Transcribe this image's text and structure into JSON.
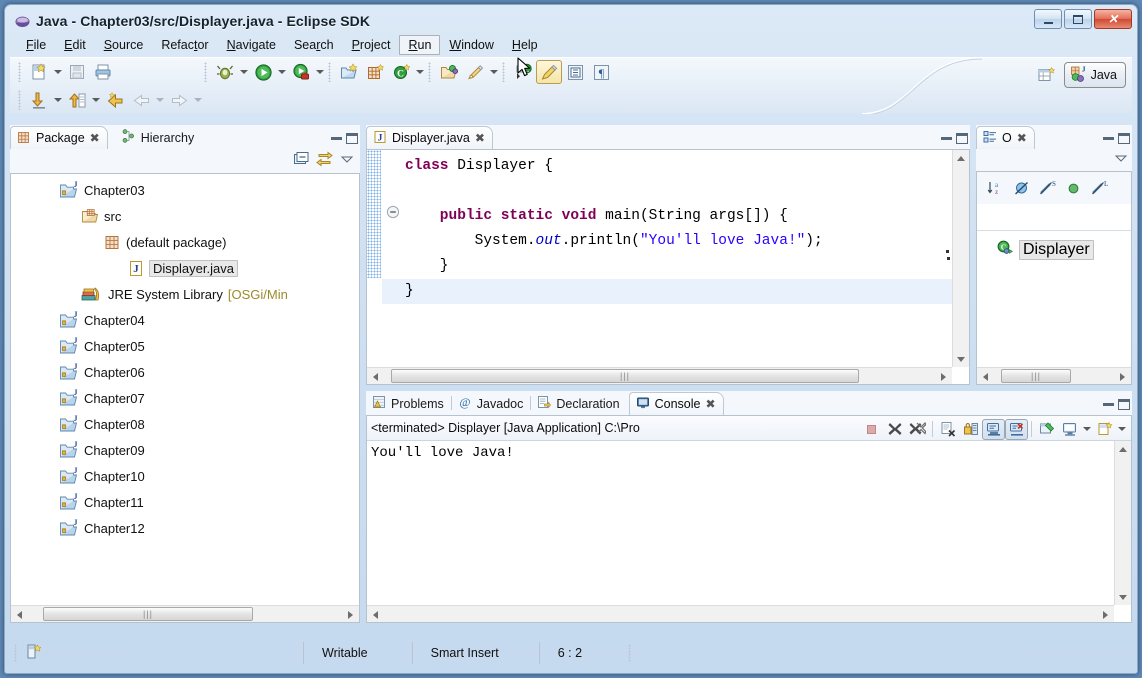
{
  "window": {
    "title": "Java - Chapter03/src/Displayer.java - Eclipse SDK",
    "logo_icon": "eclipse-logo-icon",
    "controls": [
      {
        "name": "minimize-button",
        "icon": "minimize-icon"
      },
      {
        "name": "maximize-button",
        "icon": "maximize-icon"
      },
      {
        "name": "close-button",
        "icon": "close-icon",
        "glyph": "✕"
      }
    ]
  },
  "menubar": {
    "items": [
      {
        "label": "File",
        "mnemonic": "F",
        "active": false
      },
      {
        "label": "Edit",
        "mnemonic": "E",
        "active": false
      },
      {
        "label": "Source",
        "mnemonic": "S",
        "active": false
      },
      {
        "label": "Refactor",
        "mnemonic": "t",
        "active": false
      },
      {
        "label": "Navigate",
        "mnemonic": "N",
        "active": false
      },
      {
        "label": "Search",
        "mnemonic": "r",
        "active": false
      },
      {
        "label": "Project",
        "mnemonic": "P",
        "active": false
      },
      {
        "label": "Run",
        "mnemonic": "R",
        "active": true
      },
      {
        "label": "Window",
        "mnemonic": "W",
        "active": false
      },
      {
        "label": "Help",
        "mnemonic": "H",
        "active": false
      }
    ]
  },
  "toolbar": {
    "row1": [
      {
        "name": "new-wizard-button",
        "icon": "new-file-icon"
      },
      {
        "name": "new-wizard-dropdown",
        "icon": "chevron-down-icon"
      },
      {
        "name": "save-button",
        "icon": "save-disk-icon"
      },
      {
        "name": "print-button",
        "icon": "printer-icon"
      },
      {
        "name": "debug-button",
        "icon": "debug-bug-icon"
      },
      {
        "name": "debug-dropdown",
        "icon": "chevron-down-icon"
      },
      {
        "name": "run-button",
        "icon": "run-play-icon"
      },
      {
        "name": "run-dropdown",
        "icon": "chevron-down-icon"
      },
      {
        "name": "external-tools-button",
        "icon": "external-tools-icon"
      },
      {
        "name": "external-tools-dropdown",
        "icon": "chevron-down-icon"
      },
      {
        "name": "new-java-project-button",
        "icon": "new-java-project-icon"
      },
      {
        "name": "new-package-button",
        "icon": "new-package-icon"
      },
      {
        "name": "new-class-button",
        "icon": "new-class-icon"
      },
      {
        "name": "new-class-dropdown",
        "icon": "chevron-down-icon"
      },
      {
        "name": "open-type-button",
        "icon": "open-type-icon"
      },
      {
        "name": "search-button",
        "icon": "search-pencil-icon"
      },
      {
        "name": "search-dropdown",
        "icon": "chevron-down-icon"
      },
      {
        "name": "toggle-mark-occurrences-button",
        "icon": "mark-occurrences-icon"
      },
      {
        "name": "toggle-highlight-button",
        "icon": "highlight-brush-icon"
      },
      {
        "name": "toggle-block-selection-button",
        "icon": "block-selection-icon"
      },
      {
        "name": "show-whitespace-button",
        "icon": "pilcrow-icon"
      }
    ],
    "row2": [
      {
        "name": "next-annotation-button",
        "icon": "down-arrow-annotation-icon"
      },
      {
        "name": "next-annotation-dropdown",
        "icon": "chevron-down-icon"
      },
      {
        "name": "previous-annotation-button",
        "icon": "up-arrow-annotation-icon"
      },
      {
        "name": "previous-annotation-dropdown",
        "icon": "chevron-down-icon"
      },
      {
        "name": "last-edit-location-button",
        "icon": "last-edit-location-icon"
      },
      {
        "name": "back-button",
        "icon": "back-arrow-icon"
      },
      {
        "name": "back-dropdown",
        "icon": "chevron-down-icon"
      },
      {
        "name": "forward-button",
        "icon": "forward-arrow-icon"
      },
      {
        "name": "forward-dropdown",
        "icon": "chevron-down-icon"
      }
    ],
    "perspective": {
      "open_perspective_icon": "open-perspective-icon",
      "current_label": "Java",
      "current_icon": "java-perspective-icon"
    }
  },
  "package_view": {
    "tabs": [
      {
        "label": "Package",
        "icon": "package-explorer-icon",
        "active": true,
        "close_glyph": "✖"
      },
      {
        "label": "Hierarchy",
        "icon": "hierarchy-icon",
        "active": false
      }
    ],
    "toolbar": [
      {
        "name": "collapse-all-button",
        "icon": "collapse-all-icon"
      },
      {
        "name": "link-with-editor-button",
        "icon": "link-editor-icon"
      },
      {
        "name": "view-menu-button",
        "icon": "view-menu-icon"
      }
    ],
    "tree": [
      {
        "label": "Chapter03",
        "icon": "java-project-icon",
        "indent": 0,
        "selected": false,
        "suffix": ""
      },
      {
        "label": "src",
        "icon": "source-folder-icon",
        "indent": 1,
        "selected": false,
        "suffix": ""
      },
      {
        "label": "(default package)",
        "icon": "package-icon",
        "indent": 2,
        "selected": false,
        "suffix": ""
      },
      {
        "label": "Displayer.java",
        "icon": "java-file-icon",
        "indent": 3,
        "selected": true,
        "suffix": ""
      },
      {
        "label": "JRE System Library",
        "icon": "library-icon",
        "indent": 1,
        "selected": false,
        "suffix": "[OSGi/Min"
      },
      {
        "label": "Chapter04",
        "icon": "java-project-icon",
        "indent": 0,
        "selected": false,
        "suffix": ""
      },
      {
        "label": "Chapter05",
        "icon": "java-project-icon",
        "indent": 0,
        "selected": false,
        "suffix": ""
      },
      {
        "label": "Chapter06",
        "icon": "java-project-icon",
        "indent": 0,
        "selected": false,
        "suffix": ""
      },
      {
        "label": "Chapter07",
        "icon": "java-project-icon",
        "indent": 0,
        "selected": false,
        "suffix": ""
      },
      {
        "label": "Chapter08",
        "icon": "java-project-icon",
        "indent": 0,
        "selected": false,
        "suffix": ""
      },
      {
        "label": "Chapter09",
        "icon": "java-project-icon",
        "indent": 0,
        "selected": false,
        "suffix": ""
      },
      {
        "label": "Chapter10",
        "icon": "java-project-icon",
        "indent": 0,
        "selected": false,
        "suffix": ""
      },
      {
        "label": "Chapter11",
        "icon": "java-project-icon",
        "indent": 0,
        "selected": false,
        "suffix": ""
      },
      {
        "label": "Chapter12",
        "icon": "java-project-icon",
        "indent": 0,
        "selected": false,
        "suffix": ""
      }
    ]
  },
  "editor": {
    "tab": {
      "label": "Displayer.java",
      "icon": "java-file-icon",
      "close_glyph": "✖"
    },
    "code_lines": [
      [
        {
          "t": "class ",
          "c": "kw"
        },
        {
          "t": "Displayer {",
          "c": ""
        }
      ],
      [],
      [
        {
          "t": "    public static void ",
          "c": "kw"
        },
        {
          "t": "main(String args[]) {",
          "c": ""
        }
      ],
      [
        {
          "t": "        System.",
          "c": ""
        },
        {
          "t": "out",
          "c": "fld"
        },
        {
          "t": ".println(",
          "c": ""
        },
        {
          "t": "\"You'll love Java!\"",
          "c": "str"
        },
        {
          "t": ");",
          "c": ""
        }
      ],
      [
        {
          "t": "    }",
          "c": ""
        }
      ],
      [
        {
          "t": "}",
          "c": ""
        }
      ]
    ],
    "folding_icon": "collapse-fold-icon",
    "selected_line": 6
  },
  "outline_view": {
    "tab": {
      "label": "O",
      "icon": "outline-icon",
      "close_glyph": "✖"
    },
    "toolbar": [
      {
        "name": "sort-button",
        "icon": "sort-alphabetical-icon"
      },
      {
        "name": "hide-fields-button",
        "icon": "hide-fields-icon"
      },
      {
        "name": "hide-static-button",
        "icon": "hide-static-icon"
      },
      {
        "name": "hide-nonpublic-button",
        "icon": "hide-nonpublic-icon"
      },
      {
        "name": "hide-local-types-button",
        "icon": "hide-local-types-icon"
      },
      {
        "name": "view-menu-button",
        "icon": "view-menu-icon"
      }
    ],
    "items": [
      {
        "label": "Displayer",
        "icon": "java-class-icon",
        "selected": true
      }
    ]
  },
  "bottom_panel": {
    "tabs": [
      {
        "label": "Problems",
        "icon": "problems-icon",
        "active": false
      },
      {
        "label": "Javadoc",
        "icon": "javadoc-at-icon",
        "active": false
      },
      {
        "label": "Declaration",
        "icon": "declaration-icon",
        "active": false
      },
      {
        "label": "Console",
        "icon": "console-icon",
        "active": true,
        "close_glyph": "✖"
      }
    ],
    "status_line": "<terminated> Displayer [Java Application] C:\\Pro",
    "toolbar": [
      {
        "name": "terminate-button",
        "icon": "terminate-stop-icon"
      },
      {
        "name": "remove-launch-button",
        "icon": "remove-launch-icon"
      },
      {
        "name": "remove-all-terminated-button",
        "icon": "remove-all-terminated-icon"
      },
      {
        "name": "clear-console-button",
        "icon": "clear-console-icon"
      },
      {
        "name": "scroll-lock-button",
        "icon": "scroll-lock-icon"
      },
      {
        "name": "show-console-on-output-button",
        "icon": "show-console-output-icon"
      },
      {
        "name": "show-console-on-error-button",
        "icon": "show-console-error-icon"
      },
      {
        "name": "pin-console-button",
        "icon": "pin-console-icon"
      },
      {
        "name": "display-selected-console-button",
        "icon": "display-console-icon"
      },
      {
        "name": "display-selected-console-dropdown",
        "icon": "chevron-down-icon"
      },
      {
        "name": "open-console-button",
        "icon": "open-console-icon"
      },
      {
        "name": "open-console-dropdown",
        "icon": "chevron-down-icon"
      }
    ],
    "output": "You'll love Java!"
  },
  "statusbar": {
    "left_icon": "editor-state-icon",
    "cells": [
      "Writable",
      "Smart Insert",
      "6 : 2"
    ]
  },
  "cursor": {
    "icon": "mouse-pointer-icon"
  }
}
